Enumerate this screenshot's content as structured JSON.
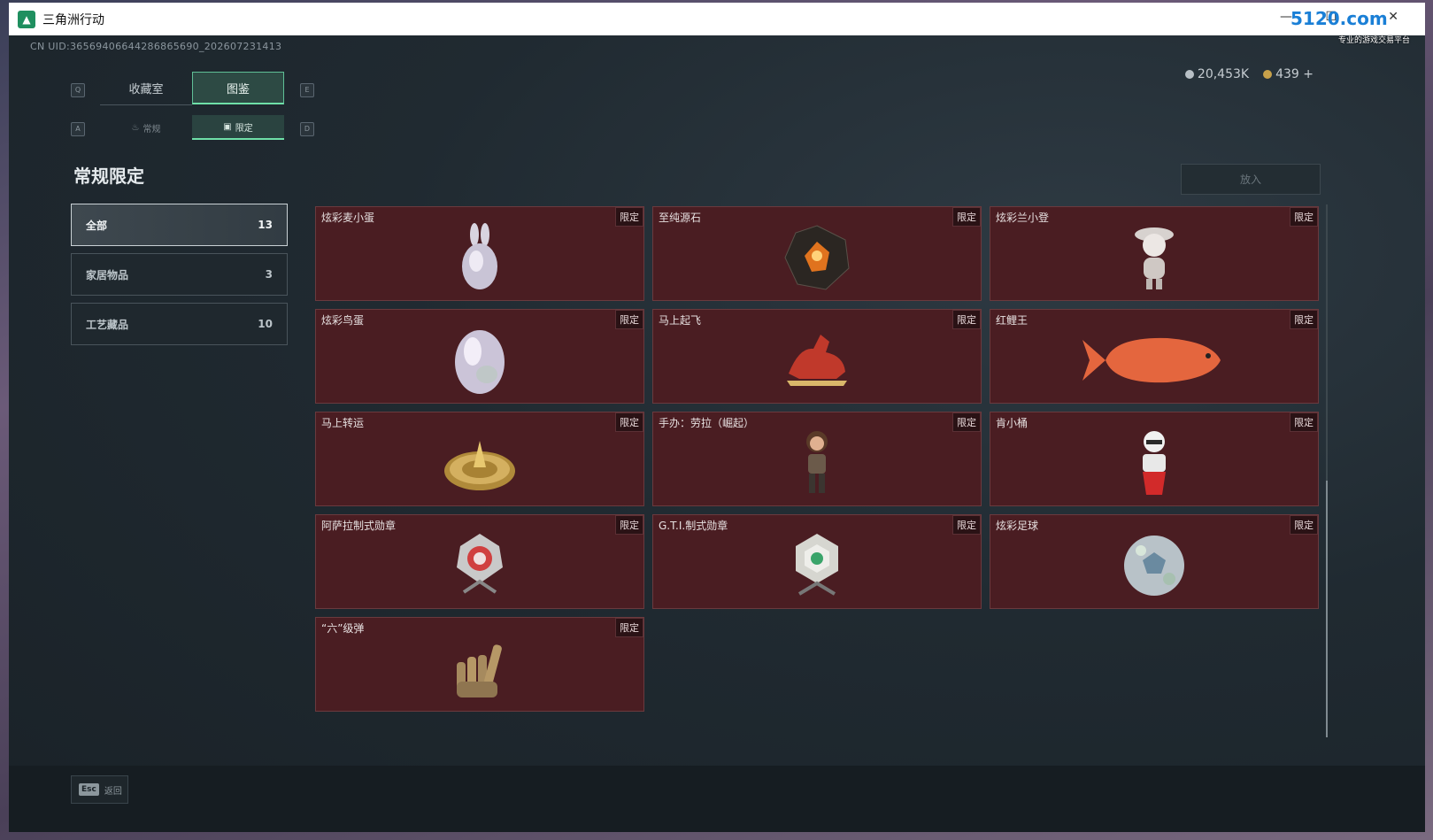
{
  "window": {
    "title": "三角洲行动",
    "minimize": "—",
    "maximize": "☐",
    "close": "✕"
  },
  "watermark": {
    "logo": "5120.com",
    "sub": "专业的游戏交易平台"
  },
  "uid": "CN UID:36569406644286865690_202607231413",
  "currency": [
    {
      "value": "20,453K",
      "color": "#b8c0c6"
    },
    {
      "value": "439 +",
      "color": "#c7a14a"
    }
  ],
  "hints": {
    "q": "Q",
    "e": "E",
    "a": "A",
    "d": "D"
  },
  "tabs": [
    {
      "label": "收藏室",
      "active": false
    },
    {
      "label": "图鉴",
      "active": true
    }
  ],
  "subtabs": [
    {
      "label": "常规",
      "icon": "flame-icon",
      "active": false
    },
    {
      "label": "限定",
      "icon": "image-icon",
      "active": true
    }
  ],
  "section_title": "常规限定",
  "place_button": "放入",
  "categories": [
    {
      "label": "全部",
      "count": "13",
      "active": true
    },
    {
      "label": "家居物品",
      "count": "3",
      "active": false
    },
    {
      "label": "工艺藏品",
      "count": "10",
      "active": false
    }
  ],
  "badge": "限定",
  "items": [
    {
      "name": "炫彩麦小蛋",
      "icon": "rabbit-egg-icon"
    },
    {
      "name": "至纯源石",
      "icon": "source-stone-icon"
    },
    {
      "name": "炫彩兰小登",
      "icon": "figure-hat-icon"
    },
    {
      "name": "炫彩鸟蛋",
      "icon": "pearl-egg-icon"
    },
    {
      "name": "马上起飞",
      "icon": "horse-icon"
    },
    {
      "name": "红鲤王",
      "icon": "carp-icon"
    },
    {
      "name": "马上转运",
      "icon": "golden-dial-icon"
    },
    {
      "name": "手办：劳拉（崛起）",
      "icon": "lara-figure-icon"
    },
    {
      "name": "肯小桶",
      "icon": "bucket-figure-icon"
    },
    {
      "name": "阿萨拉制式勋章",
      "icon": "asala-medal-icon"
    },
    {
      "name": "G.T.I.制式勋章",
      "icon": "gti-medal-icon"
    },
    {
      "name": "炫彩足球",
      "icon": "football-icon"
    },
    {
      "name": "“六”级弹",
      "icon": "bullet-hand-icon"
    }
  ],
  "footer": {
    "esc_key": "Esc",
    "esc_label": "返回"
  }
}
